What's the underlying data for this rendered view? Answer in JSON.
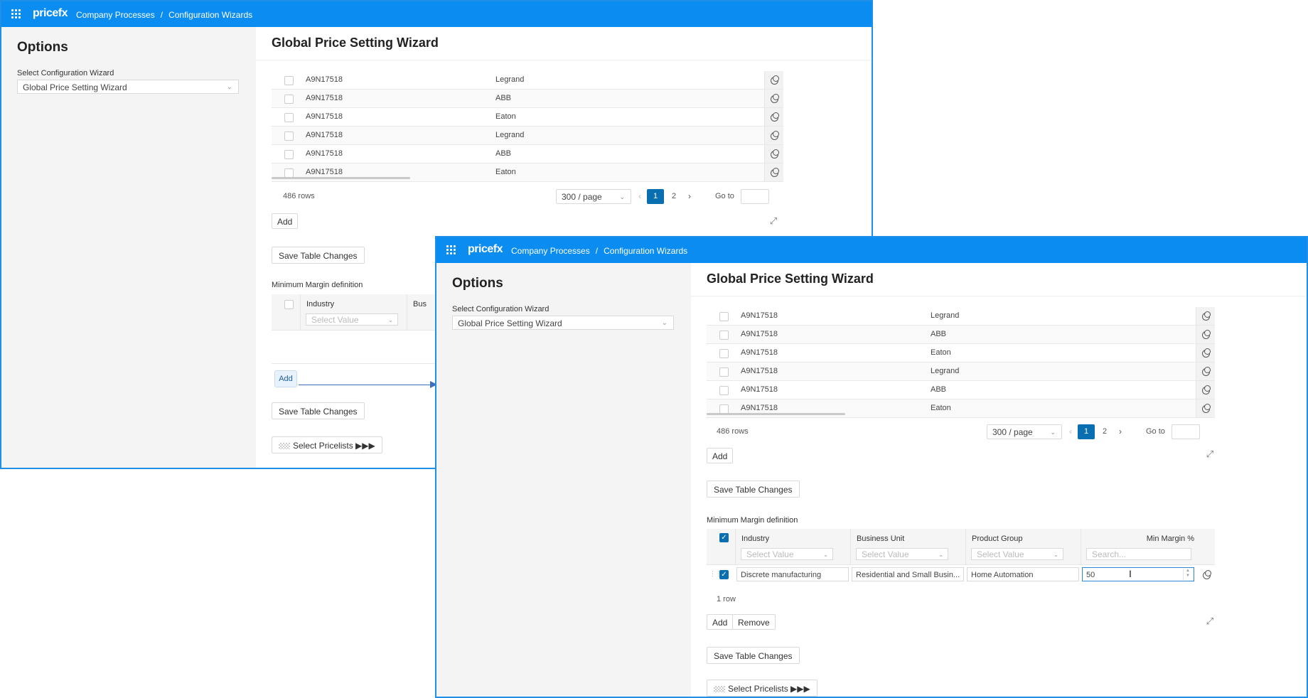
{
  "app": {
    "logo": "pricefx",
    "breadcrumb": [
      "Company Processes",
      "Configuration Wizards"
    ],
    "breadcrumb_sep": "/"
  },
  "sidebar": {
    "title": "Options",
    "select_label": "Select Configuration Wizard",
    "select_value": "Global Price Setting Wizard"
  },
  "main": {
    "title": "Global Price Setting Wizard",
    "table_rows": [
      {
        "id": "A9N17518",
        "brand": "Legrand"
      },
      {
        "id": "A9N17518",
        "brand": "ABB"
      },
      {
        "id": "A9N17518",
        "brand": "Eaton"
      },
      {
        "id": "A9N17518",
        "brand": "Legrand"
      },
      {
        "id": "A9N17518",
        "brand": "ABB"
      },
      {
        "id": "A9N17518",
        "brand": "Eaton"
      }
    ],
    "rows_count": "486 rows",
    "page_size": "300 / page",
    "current_page": "1",
    "next_page": "2",
    "goto_label": "Go to",
    "add_label": "Add",
    "remove_label": "Remove",
    "save_label": "Save Table Changes",
    "select_pricelists_label": "Select Pricelists ▶▶▶",
    "min_margin": {
      "title": "Minimum Margin definition",
      "columns": [
        "Industry",
        "Business Unit",
        "Product Group",
        "Min Margin %"
      ],
      "filter_placeholder": "Select Value",
      "search_placeholder": "Search...",
      "row": {
        "industry": "Discrete manufacturing",
        "business_unit": "Residential and Small Busin...",
        "product_group": "Home Automation",
        "min_margin": "50"
      },
      "row_count": "1 row",
      "back_column_partial": "Bus"
    }
  },
  "colors": {
    "topbar": "#0a8cf0",
    "accent": "#0a6fb0",
    "window_border": "#1f8fe8"
  }
}
